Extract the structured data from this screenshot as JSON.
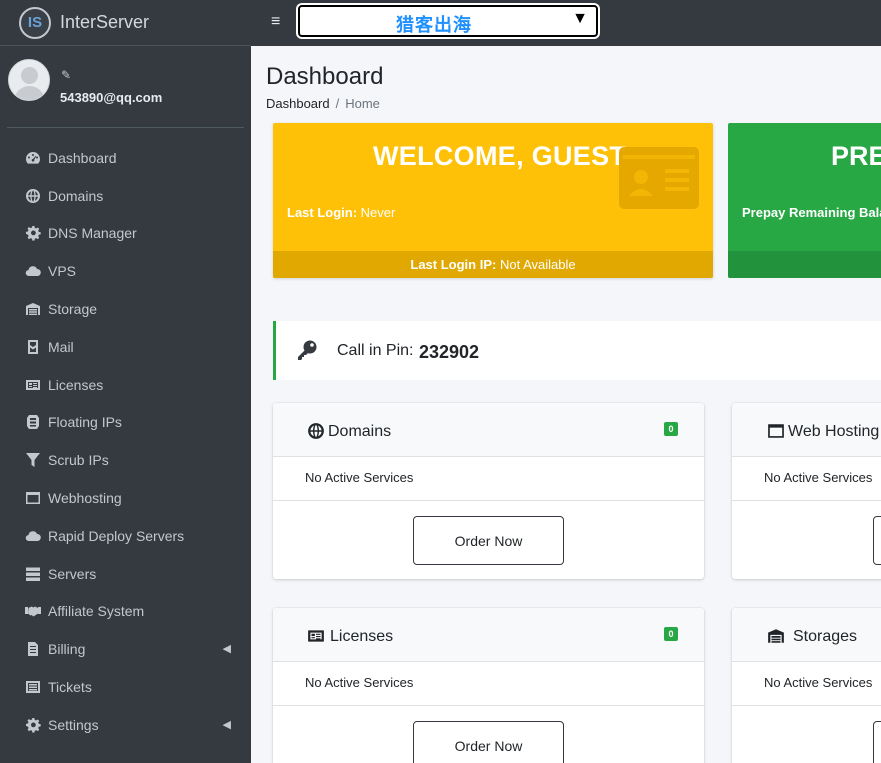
{
  "brand": {
    "name": "InterServer",
    "logo_text": "IS"
  },
  "user": {
    "email": "543890@qq.com"
  },
  "sidebar": {
    "items": [
      {
        "label": "Dashboard",
        "icon": "tachometer-icon"
      },
      {
        "label": "Domains",
        "icon": "globe-icon"
      },
      {
        "label": "DNS Manager",
        "icon": "cog-icon"
      },
      {
        "label": "VPS",
        "icon": "cloud-icon"
      },
      {
        "label": "Storage",
        "icon": "warehouse-icon"
      },
      {
        "label": "Mail",
        "icon": "mail-icon"
      },
      {
        "label": "Licenses",
        "icon": "id-card-icon"
      },
      {
        "label": "Floating IPs",
        "icon": "network-icon"
      },
      {
        "label": "Scrub IPs",
        "icon": "filter-icon"
      },
      {
        "label": "Webhosting",
        "icon": "window-icon"
      },
      {
        "label": "Rapid Deploy Servers",
        "icon": "cloud-icon"
      },
      {
        "label": "Servers",
        "icon": "server-icon"
      },
      {
        "label": "Affiliate System",
        "icon": "handshake-icon"
      },
      {
        "label": "Billing",
        "icon": "invoice-icon"
      },
      {
        "label": "Tickets",
        "icon": "ticket-icon"
      },
      {
        "label": "Settings",
        "icon": "cog-icon"
      }
    ]
  },
  "topbar": {
    "hamburger": "≡",
    "select_value": "猎客出海"
  },
  "header": {
    "title": "Dashboard",
    "breadcrumb": [
      "Dashboard",
      "Home"
    ]
  },
  "welcome": {
    "title": "WELCOME, GUEST",
    "last_login_label": "Last Login:",
    "last_login_value": "Never",
    "last_login_ip_label": "Last Login IP:",
    "last_login_ip_value": "Not Available"
  },
  "prepay": {
    "title": "PRE",
    "label": "Prepay Remaining Bala"
  },
  "pin": {
    "label": "Call in Pin:",
    "value": "232902"
  },
  "cards": {
    "domains": {
      "title": "Domains",
      "badge": "0",
      "status": "No Active Services",
      "button": "Order Now"
    },
    "webhosting": {
      "title": "Web Hosting",
      "status": "No Active Services"
    },
    "licenses": {
      "title": "Licenses",
      "badge": "0",
      "status": "No Active Services",
      "button": "Order Now"
    },
    "storages": {
      "title": "Storages",
      "status": "No Active Services"
    }
  },
  "colors": {
    "sidebar_bg": "#343a40",
    "warning": "#ffc107",
    "success": "#28a745",
    "select_text": "#1e90ff"
  }
}
